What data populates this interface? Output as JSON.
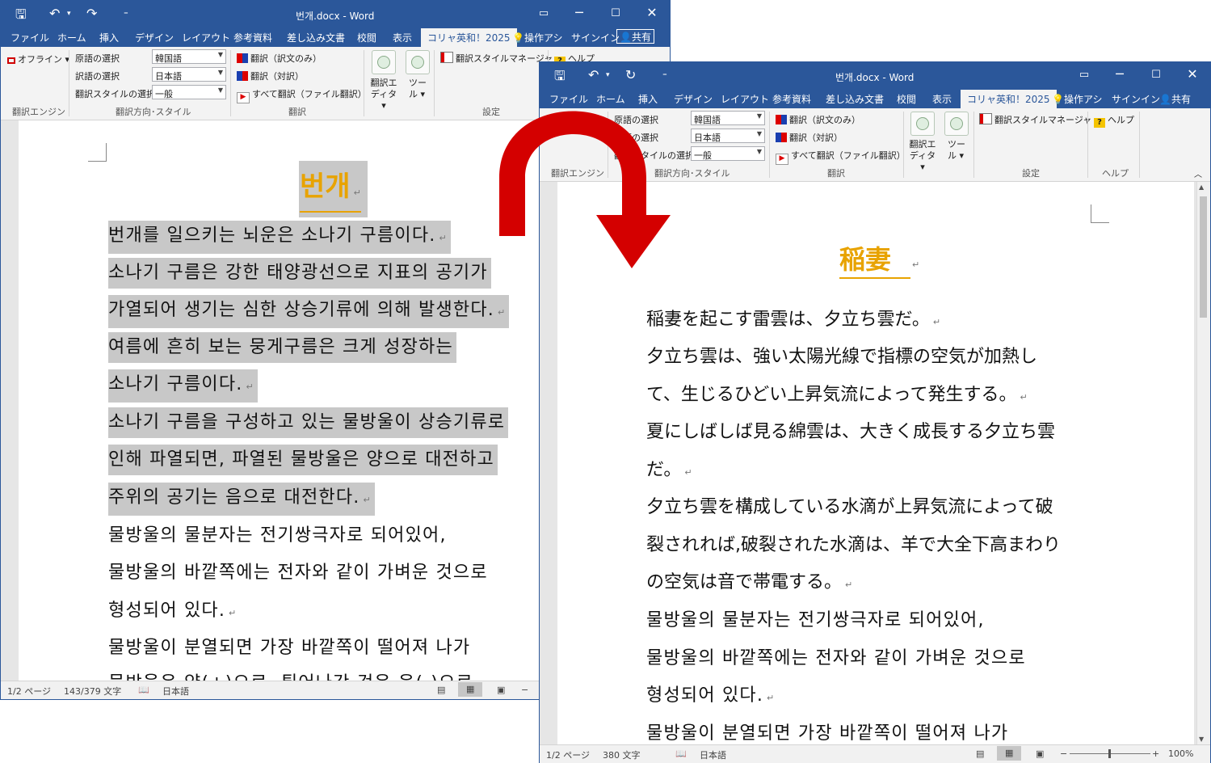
{
  "common": {
    "menu_tabs": [
      "ファイル",
      "ホーム",
      "挿入",
      "デザイン",
      "レイアウト",
      "参考資料",
      "差し込み文書",
      "校閲",
      "表示",
      "コリャ英和！2025",
      "操作アシ",
      "サインイン",
      "共有"
    ],
    "ribbon": {
      "engine_label": "オフライン",
      "source_lang_label": "原語の選択",
      "target_lang_label": "訳語の選択",
      "style_label": "翻訳スタイルの選択",
      "source_lang_value": "韓国語",
      "target_lang_value": "日本語",
      "style_value": "一般",
      "translate_only": "翻訳（訳文のみ）",
      "translate_parallel": "翻訳（対訳）",
      "translate_all": "すべて翻訳（ファイル翻訳）",
      "editor_label": "翻訳エディタ",
      "tools_label": "ツール",
      "style_manager": "翻訳スタイルマネージャ",
      "help": "ヘルプ",
      "group_engine": "翻訳エンジン",
      "group_direction": "翻訳方向･スタイル",
      "group_translate": "翻訳",
      "group_settings": "設定",
      "group_help": "ヘルプ"
    },
    "colors": {
      "title_blue": "#2b579a",
      "heading_gold": "#e8a300",
      "arrow_red": "#d40000",
      "highlight_gray": "#c8c8c8"
    }
  },
  "window1": {
    "title": "번개.docx - Word",
    "heading": "번개",
    "lines": [
      "번개를 일으키는 뇌운은 소나기 구름이다.",
      "소나기 구름은 강한 태양광선으로 지표의 공기가",
      "가열되어 생기는 심한 상승기류에 의해 발생한다.",
      "여름에 흔히 보는 뭉게구름은 크게 성장하는",
      "소나기 구름이다.",
      "소나기 구름을 구성하고 있는 물방울이 상승기류로",
      "인해 파열되면, 파열된 물방울은 양으로 대전하고",
      "주위의 공기는 음으로 대전한다.",
      "물방울의 물분자는 전기쌍극자로 되어있어,",
      "물방울의 바깥쪽에는 전자와 같이 가벼운 것으로",
      "형성되어 있다.",
      "물방울이 분열되면 가장 바깥쪽이 떨어져 나가",
      "물방울은 양(+)으로, 튀어나간 것은 음(-)으로"
    ],
    "status": {
      "page": "1/2 ページ",
      "words": "143/379 文字",
      "lang": "日本語"
    }
  },
  "window2": {
    "title": "번개.docx - Word",
    "heading": "稲妻",
    "lines": [
      "稲妻を起こす雷雲は、夕立ち雲だ。",
      "夕立ち雲は、強い太陽光線で指標の空気が加熱し",
      "て、生じるひどい上昇気流によって発生する。",
      "夏にしばしば見る綿雲は、大きく成長する夕立ち雲",
      "だ。",
      "夕立ち雲を構成している水滴が上昇気流によって破",
      "裂されれば,破裂された水滴は、羊で大全下高まわり",
      "の空気は音で帯電する。",
      "물방울의 물분자는 전기쌍극자로 되어있어,",
      "물방울의 바깥쪽에는 전자와 같이 가벼운 것으로",
      "형성되어 있다.",
      "물방울이 분열되면 가장 바깥쪽이 떨어져 나가"
    ],
    "status": {
      "page": "1/2 ページ",
      "words": "380 文字",
      "lang": "日本語",
      "zoom": "100%"
    }
  }
}
